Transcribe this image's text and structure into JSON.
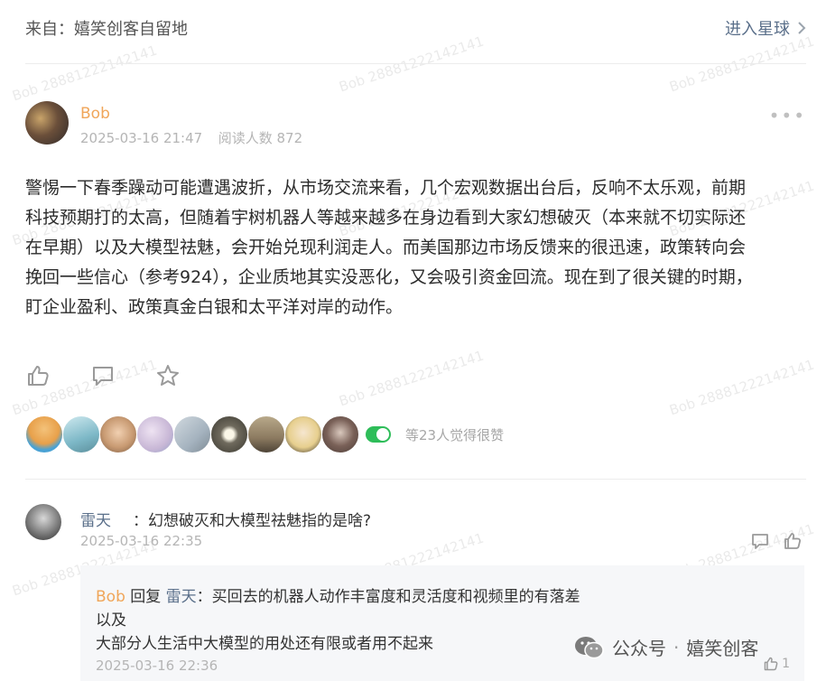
{
  "header": {
    "from_label": "来自：嬉笑创客自留地",
    "enter_label": "进入星球",
    "chevron": "chevron-right-icon"
  },
  "post": {
    "author": "Bob",
    "date": "2025-03-16 21:47",
    "reads": "阅读人数 872",
    "more": "•••",
    "lines": [
      "警惕一下春季躁动可能遭遇波折，从市场交流来看，几个宏观数据出台后，反响不太乐观，前期",
      "科技预期打的太高，但随着宇树机器人等越来越多在身边看到大家幻想破灭（本来就不切实际还",
      "在早期）以及大模型祛魅，会开始兑现利润走人。而美国那边市场反馈来的很迅速，政策转向会",
      "挽回一些信心（参考924），企业质地其实没恶化，又会吸引资金回流。现在到了很关键的时期，",
      "盯企业盈利、政策真金白银和太平洋对岸的动作。"
    ],
    "liked_text": "等23人觉得很赞"
  },
  "likers": [
    {
      "name": "liker-1",
      "color": "#e8a04a"
    },
    {
      "name": "liker-2",
      "color": "#7db8c7"
    },
    {
      "name": "liker-3",
      "color": "#c89a72"
    },
    {
      "name": "liker-4",
      "color": "#c8b7d6"
    },
    {
      "name": "liker-5",
      "color": "#a5b3bf"
    },
    {
      "name": "liker-6",
      "color": "#6f6a5d"
    },
    {
      "name": "liker-7",
      "color": "#8c7a60"
    },
    {
      "name": "liker-8",
      "color": "#e7cf8e"
    },
    {
      "name": "liker-9",
      "color": "#4a3b36"
    }
  ],
  "comment": {
    "name": "雷天",
    "text": "：幻想破灭和大模型祛魅指的是啥?",
    "date": "2025-03-16 22:35"
  },
  "reply": {
    "from": "Bob",
    "verb": " 回复 ",
    "to": "雷天",
    "colon_text": "：买回去的机器人动作丰富度和灵活度和视频里的有落差",
    "line2": "以及",
    "line3": "大部分人生活中大模型的用处还有限或者用不起来",
    "date": "2025-03-16 22:36",
    "like_count": "1"
  },
  "watermark": "Bob 28881222142141",
  "brand": {
    "icon": "wechat-icon",
    "name": "公众号",
    "dot": "·",
    "account": "嬉笑创客"
  }
}
